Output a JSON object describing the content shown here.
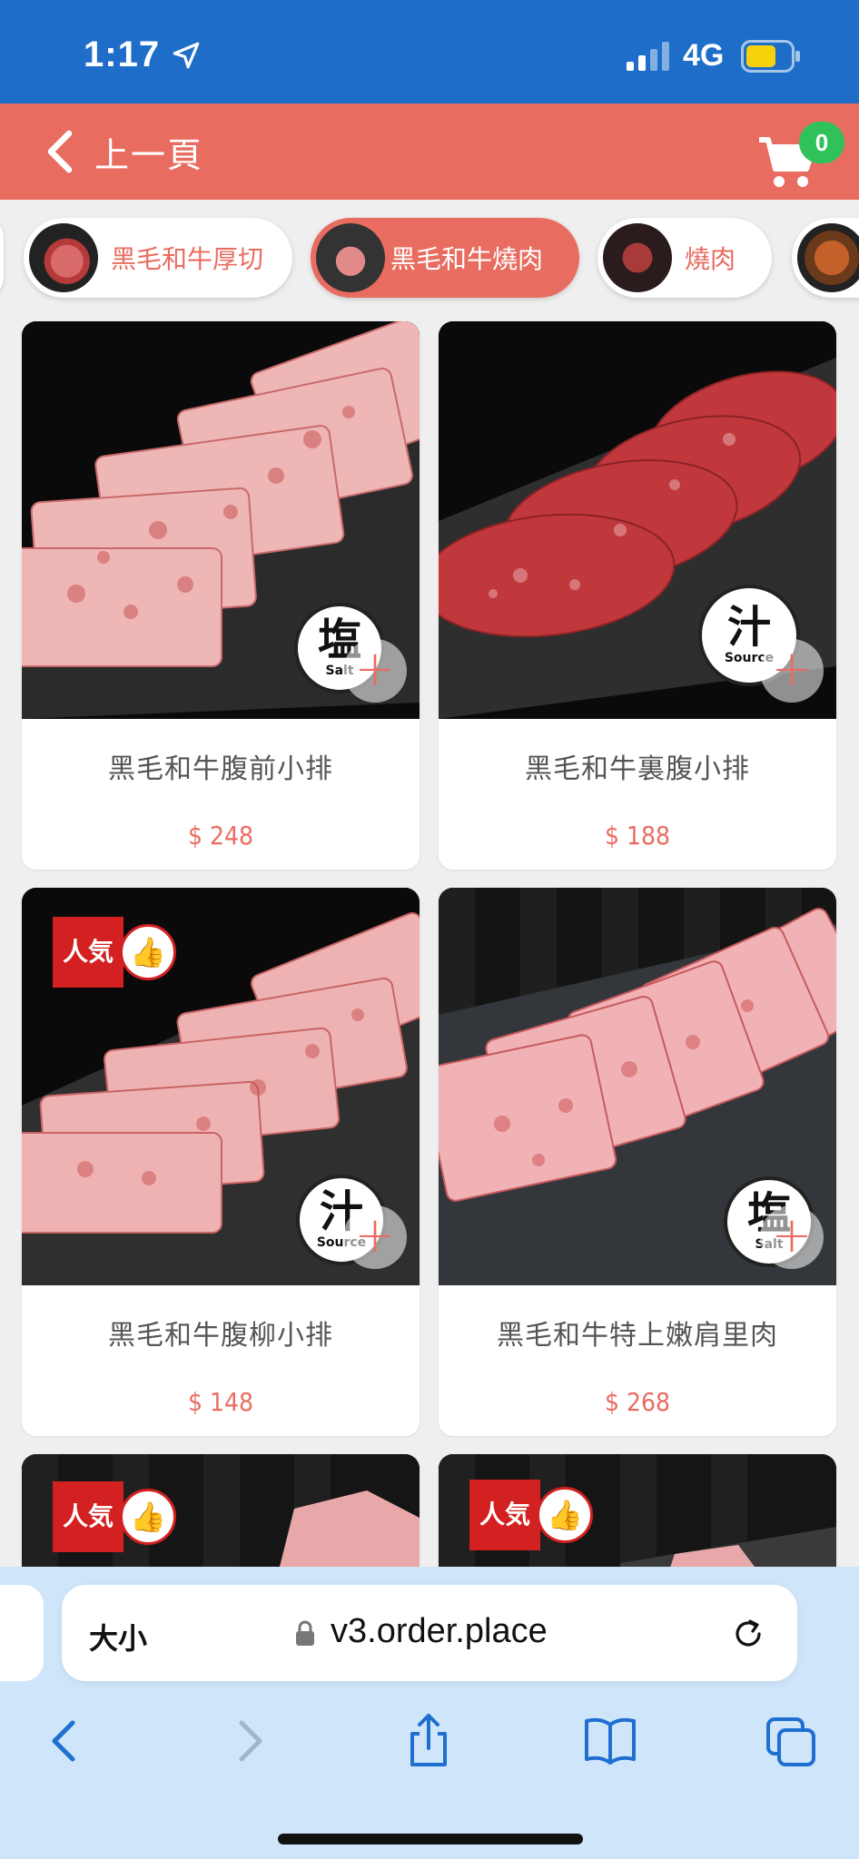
{
  "status_bar": {
    "time": "1:17",
    "network": "4G"
  },
  "header": {
    "back_label": "上一頁",
    "cart_count": "0"
  },
  "categories": [
    {
      "label": "黑毛和牛厚切",
      "active": false
    },
    {
      "label": "黑毛和牛燒肉",
      "active": true
    },
    {
      "label": "燒肉",
      "active": false
    }
  ],
  "products": [
    {
      "name": "黑毛和牛腹前小排",
      "price": "$ 248",
      "stamp": "塩",
      "stamp_sub": "Salt"
    },
    {
      "name": "黑毛和牛裏腹小排",
      "price": "$ 188",
      "stamp": "汁",
      "stamp_sub": "Source"
    },
    {
      "name": "黑毛和牛腹柳小排",
      "price": "$ 148",
      "stamp": "汁",
      "stamp_sub": "Source",
      "badge": "人気"
    },
    {
      "name": "黑毛和牛特上嫩肩里肉",
      "price": "$ 268",
      "stamp": "塩",
      "stamp_sub": "Salt"
    }
  ],
  "partial_badges": {
    "left": "人気",
    "right": "人気"
  },
  "browser": {
    "text_size": "大小",
    "url": "v3.order.place"
  },
  "colors": {
    "accent": "#e96c60",
    "status_bar": "#1e6ec9",
    "badge_green": "#2fc25b",
    "browser_bg": "#cfe6fa"
  }
}
